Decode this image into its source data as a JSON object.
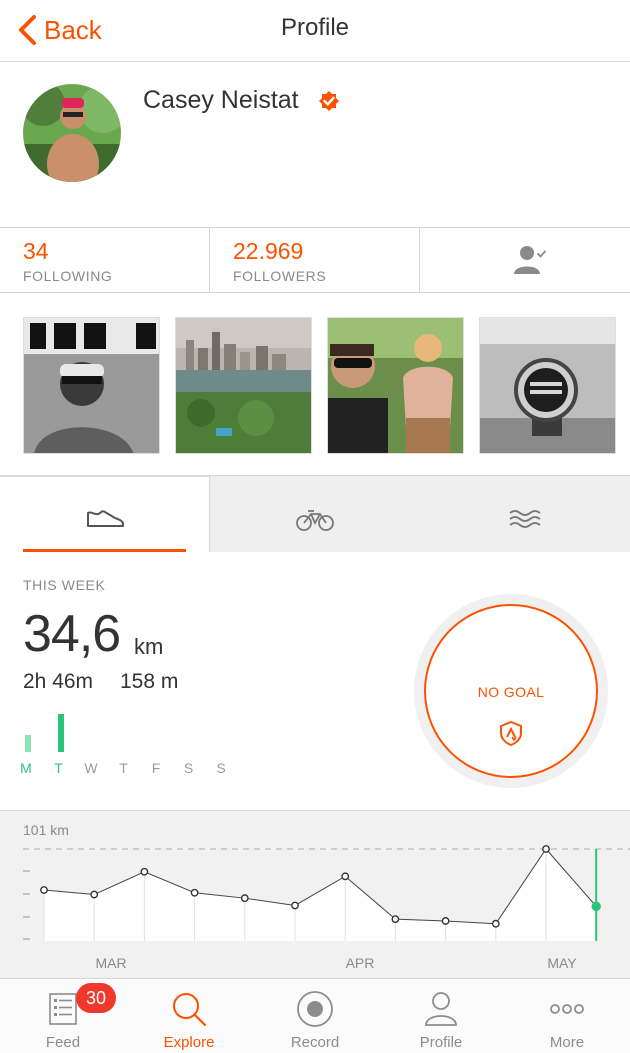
{
  "nav": {
    "back_label": "Back",
    "title": "Profile"
  },
  "athlete": {
    "name": "Casey Neistat",
    "verified": true
  },
  "stats": {
    "following_count": "34",
    "following_label": "FOLLOWING",
    "followers_count": "22.969",
    "followers_label": "FOLLOWERS"
  },
  "activity_tabs": [
    {
      "name": "run",
      "icon": "shoe-icon",
      "active": true
    },
    {
      "name": "ride",
      "icon": "bike-icon",
      "active": false
    },
    {
      "name": "swim",
      "icon": "waves-icon",
      "active": false
    }
  ],
  "this_week": {
    "title": "THIS WEEK",
    "distance": "34,6",
    "distance_unit": "km",
    "time": "2h 46m",
    "elevation": "158 m",
    "days": [
      "M",
      "T",
      "W",
      "T",
      "F",
      "S",
      "S"
    ],
    "day_activity": [
      0.45,
      1.0,
      0,
      0,
      0,
      0,
      0
    ],
    "goal_label": "NO GOAL"
  },
  "weekly_chart": {
    "max_label": "101 km",
    "month_labels": [
      "MAR",
      "APR",
      "MAY"
    ],
    "values": [
      56,
      51,
      76,
      53,
      47,
      39,
      71,
      24,
      22,
      19,
      101,
      38
    ]
  },
  "tabbar": {
    "items": [
      {
        "label": "Feed",
        "icon": "feed-icon",
        "badge": "30"
      },
      {
        "label": "Explore",
        "icon": "search-icon",
        "active": true
      },
      {
        "label": "Record",
        "icon": "record-icon"
      },
      {
        "label": "Profile",
        "icon": "profile-icon"
      },
      {
        "label": "More",
        "icon": "more-icon"
      }
    ]
  },
  "colors": {
    "accent": "#fc5200",
    "run_green": "#2dc37a",
    "badge_red": "#f0392b"
  }
}
